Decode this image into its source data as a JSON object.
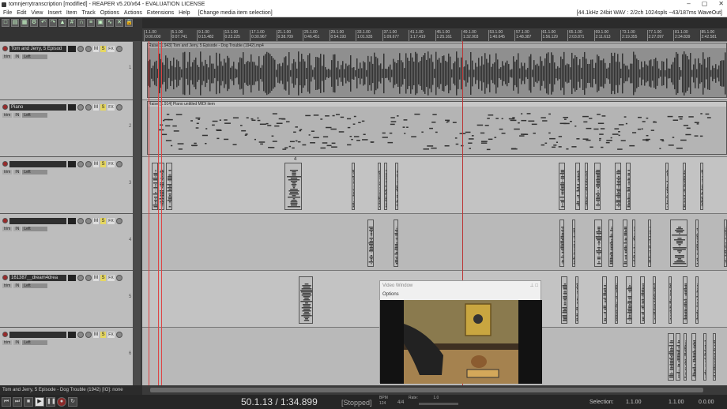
{
  "window": {
    "title": "tomnjerrytranscription [modified] - REAPER v5.20/x64 - EVALUATION LICENSE",
    "controls": [
      "–",
      "▢",
      "✕"
    ]
  },
  "menu": {
    "items": [
      "File",
      "Edit",
      "View",
      "Insert",
      "Item",
      "Track",
      "Options",
      "Actions",
      "Extensions",
      "Help"
    ],
    "undo_hint": "[Change media item selection]",
    "status": "[44.1kHz 24bit WAV : 2/2ch 1024spls ~43/187ms WaveOut]"
  },
  "ruler": {
    "ticks": [
      {
        "bar": "1.1.00",
        "time": "0:00.000"
      },
      {
        "bar": "5.1.00",
        "time": "0:07.741"
      },
      {
        "bar": "9.1.00",
        "time": "0:15.482"
      },
      {
        "bar": "13.1.00",
        "time": "0:23.225"
      },
      {
        "bar": "17.1.00",
        "time": "0:30.967"
      },
      {
        "bar": "21.1.00",
        "time": "0:38.709"
      },
      {
        "bar": "25.1.00",
        "time": "0:46.451"
      },
      {
        "bar": "29.1.00",
        "time": "0:54.193"
      },
      {
        "bar": "33.1.00",
        "time": "1:01.935"
      },
      {
        "bar": "37.1.00",
        "time": "1:09.677"
      },
      {
        "bar": "41.1.00",
        "time": "1:17.419"
      },
      {
        "bar": "45.1.00",
        "time": "1:25.161"
      },
      {
        "bar": "49.1.00",
        "time": "1:32.903"
      },
      {
        "bar": "53.1.00",
        "time": "1:40.645"
      },
      {
        "bar": "57.1.00",
        "time": "1:48.387"
      },
      {
        "bar": "61.1.00",
        "time": "1:56.129"
      },
      {
        "bar": "65.1.00",
        "time": "2:03.871"
      },
      {
        "bar": "69.1.00",
        "time": "2:11.613"
      },
      {
        "bar": "73.1.00",
        "time": "2:19.355"
      },
      {
        "bar": "77.1.00",
        "time": "2:27.097"
      },
      {
        "bar": "81.1.00",
        "time": "2:34.839"
      },
      {
        "bar": "85.1.00",
        "time": "2:42.581"
      }
    ]
  },
  "tracks": [
    {
      "num": "1",
      "name": "Tom and Jerry, 5 Episod",
      "pan": "Left",
      "in": "IN",
      "trim": "trim"
    },
    {
      "num": "2",
      "name": "Piano",
      "pan": "Left",
      "in": "IN",
      "trim": "trim"
    },
    {
      "num": "3",
      "name": "",
      "pan": "Left",
      "in": "IN",
      "trim": "trim"
    },
    {
      "num": "4",
      "name": "",
      "pan": "Left",
      "in": "IN",
      "trim": "trim"
    },
    {
      "num": "5",
      "name": "161387__dream4drea",
      "pan": "Left",
      "in": "IN",
      "trim": "trim"
    },
    {
      "num": "6",
      "name": "",
      "pan": "Left",
      "in": "IN",
      "trim": "trim"
    }
  ],
  "items": {
    "track1_label": "Raise [1.943] Tom and Jerry, 5 Episode - Dog Trouble (1942).mp4",
    "track2_label": "Raise [1.914] Piano untitled MIDI item",
    "track3_marker": "4"
  },
  "video_window": {
    "title": "Video Window",
    "menu": "Options"
  },
  "status_line": "Tom and Jerry, 5 Episode - Dog Trouble (1942) [IO]: none",
  "transport": {
    "time": "50.1.13 / 1:34.899",
    "state": "[Stopped]",
    "bpm_label": "BPM",
    "bpm": "124",
    "time_sig": "4/4",
    "rate_label": "Rate:",
    "rate": "1.0",
    "selection_label": "Selection:",
    "sel_start": "1.1.00",
    "sel_end": "1.1.00",
    "sel_len": "0.0.00"
  },
  "colors": {
    "accent_red": "#d44444",
    "marker_teal": "#2a9db0"
  }
}
